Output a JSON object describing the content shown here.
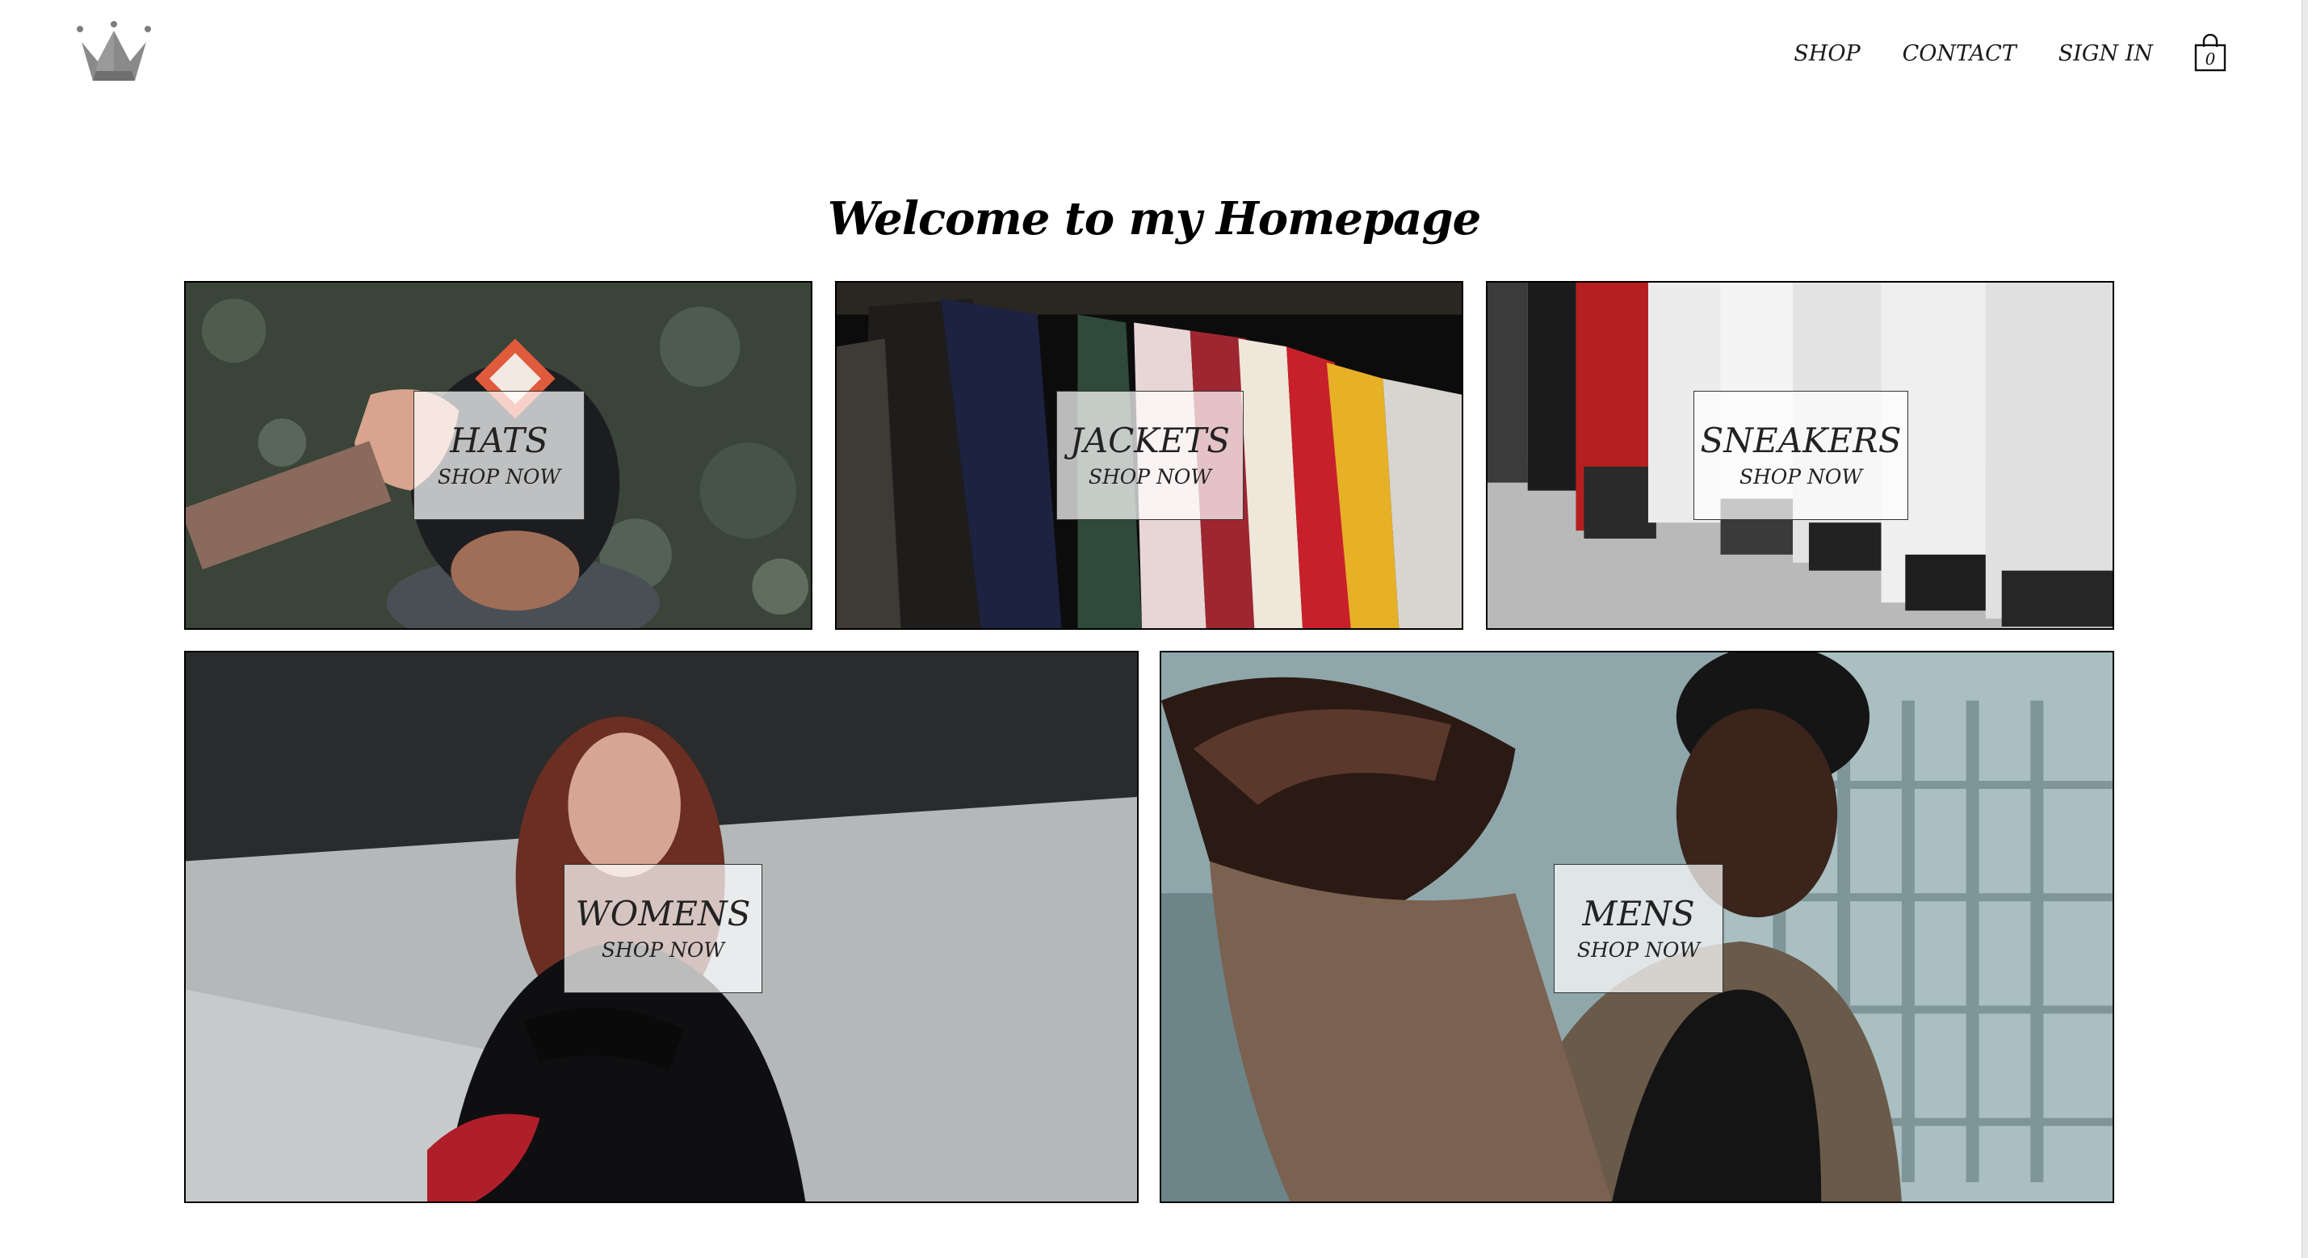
{
  "header": {
    "logo_icon": "crown-icon",
    "nav": {
      "shop": "SHOP",
      "contact": "CONTACT",
      "sign_in": "SIGN IN"
    },
    "cart": {
      "icon": "shopping-bag-icon",
      "count": "0"
    }
  },
  "main": {
    "title": "Welcome to my Homepage",
    "categories": [
      {
        "title": "HATS",
        "cta": "SHOP NOW"
      },
      {
        "title": "JACKETS",
        "cta": "SHOP NOW"
      },
      {
        "title": "SNEAKERS",
        "cta": "SHOP NOW"
      },
      {
        "title": "WOMENS",
        "cta": "SHOP NOW"
      },
      {
        "title": "MENS",
        "cta": "SHOP NOW"
      }
    ]
  },
  "colors": {
    "background": "#ffffff",
    "text": "#1a1a1a",
    "logo": "#808080",
    "label_overlay": "rgba(255,255,255,0.72)"
  }
}
